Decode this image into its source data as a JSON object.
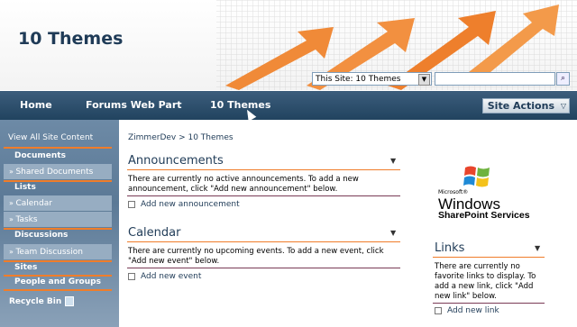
{
  "header": {
    "site_title": "10 Themes",
    "search_scope": "This Site: 10 Themes",
    "search_placeholder": ""
  },
  "topnav": {
    "tabs": [
      "Home",
      "Forums Web Part",
      "10 Themes"
    ],
    "site_actions": "Site Actions"
  },
  "leftnav": {
    "view_all": "View All Site Content",
    "documents": "Documents",
    "shared_documents": "Shared Documents",
    "lists": "Lists",
    "calendar": "Calendar",
    "tasks": "Tasks",
    "discussions": "Discussions",
    "team_discussion": "Team Discussion",
    "sites": "Sites",
    "people_groups": "People and Groups",
    "recycle_bin": "Recycle Bin"
  },
  "main": {
    "breadcrumb": "ZimmerDev > 10 Themes",
    "announcements": {
      "title": "Announcements",
      "body": "There are currently no active announcements. To add a new announcement, click \"Add new announcement\" below.",
      "add": "Add new announcement"
    },
    "calendar": {
      "title": "Calendar",
      "body": "There are currently no upcoming events. To add a new event, click \"Add new event\" below.",
      "add": "Add new event"
    },
    "links": {
      "title": "Links",
      "body": "There are currently no favorite links to display. To add a new link, click \"Add new link\" below.",
      "add": "Add new link"
    },
    "logo": {
      "ms": "Microsoft®",
      "windows": "Windows",
      "sps": "SharePoint Services"
    }
  },
  "colors": {
    "accent": "#f07d2a",
    "nav": "#21435f",
    "title": "#1f3b57"
  }
}
